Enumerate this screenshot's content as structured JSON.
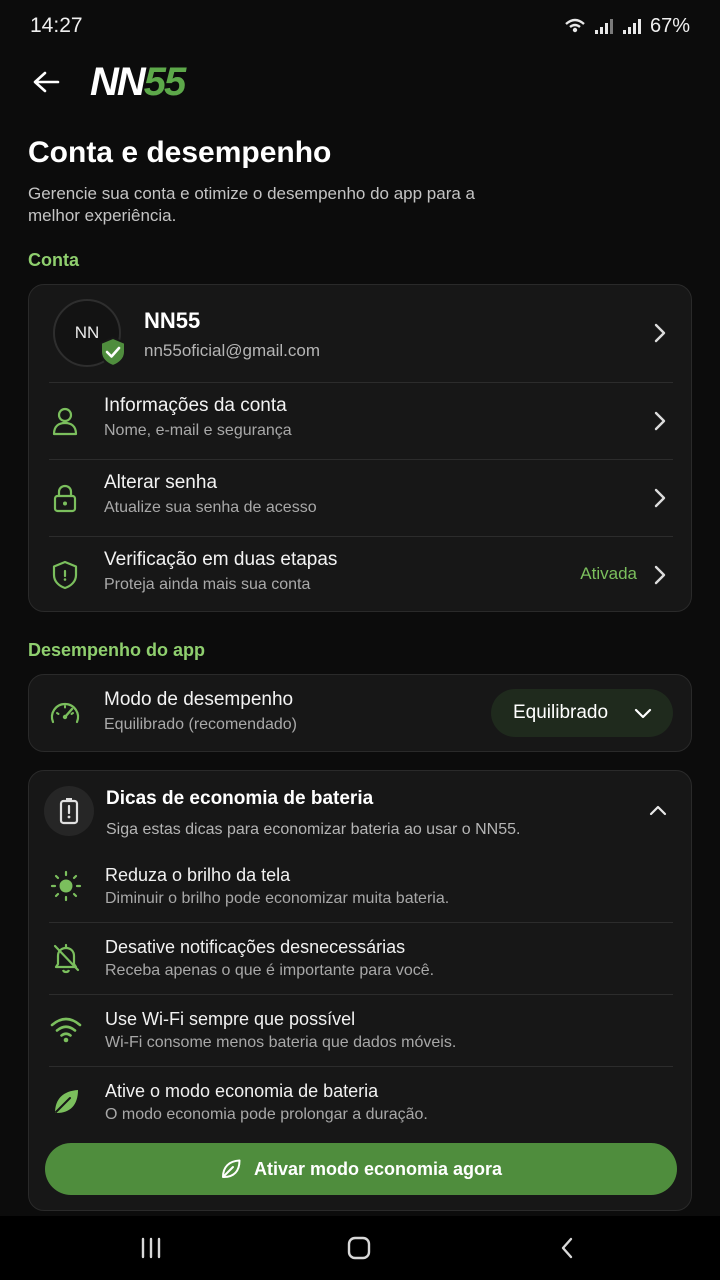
{
  "status_bar": {
    "time": "14:27",
    "battery": "67%"
  },
  "header": {
    "logo_left": "NN",
    "logo_right": "55"
  },
  "page": {
    "title": "Conta e desempenho",
    "subtitle": "Gerencie sua conta e otimize o desempenho do app para a melhor experiência."
  },
  "account_section": {
    "label": "Conta",
    "profile": {
      "initials": "NN",
      "name": "NN55",
      "email": "nn55oficial@gmail.com"
    },
    "items": [
      {
        "title": "Informações da conta",
        "desc": "Nome, e-mail e segurança",
        "icon": "user-icon"
      },
      {
        "title": "Alterar senha",
        "desc": "Atualize sua senha de acesso",
        "icon": "lock-icon"
      },
      {
        "title": "Verificação em duas etapas",
        "desc": "Proteja ainda mais sua conta",
        "icon": "shield-icon",
        "status": "Ativada"
      }
    ]
  },
  "performance_section": {
    "label": "Desempenho do app",
    "mode_title": "Modo de desempenho",
    "mode_desc": "Equilibrado (recomendado)",
    "mode_value": "Equilibrado"
  },
  "battery_tips": {
    "title": "Dicas de economia de bateria",
    "subtitle": "Siga estas dicas para economizar bateria ao usar o NN55.",
    "tips": [
      {
        "title": "Reduza o brilho da tela",
        "desc": "Diminuir o brilho pode economizar muita bateria.",
        "icon": "brightness-icon"
      },
      {
        "title": "Desative notificações desnecessárias",
        "desc": "Receba apenas o que é importante para você.",
        "icon": "bell-off-icon"
      },
      {
        "title": "Use Wi-Fi sempre que possível",
        "desc": "Wi-Fi consome menos bateria que dados móveis.",
        "icon": "wifi-icon"
      },
      {
        "title": "Ative o modo economia de bateria",
        "desc": "O modo economia pode prolongar a duração.",
        "icon": "leaf-icon"
      }
    ],
    "cta_label": "Ativar modo economia agora"
  },
  "colors": {
    "accent": "#8fcf6e",
    "accent_dark": "#4f8d3d",
    "background": "#0c0c0c",
    "card": "#171717"
  }
}
